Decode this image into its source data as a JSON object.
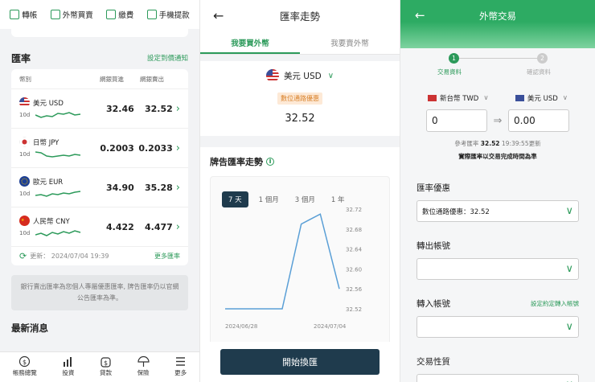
{
  "panel1": {
    "toolbar": [
      {
        "label": "轉帳",
        "icon": "transfer-icon"
      },
      {
        "label": "外幣買賣",
        "icon": "fx-trade-icon"
      },
      {
        "label": "繳費",
        "icon": "bill-icon"
      },
      {
        "label": "手機提款",
        "icon": "atm-icon"
      }
    ],
    "rates_title": "匯率",
    "notify_link": "設定到價通知",
    "headers": {
      "currency": "幣別",
      "buy": "網銀買進",
      "sell": "網銀賣出"
    },
    "rows": [
      {
        "name": "美元 USD",
        "period": "10d",
        "buy": "32.46",
        "sell": "32.52",
        "flag": "us"
      },
      {
        "name": "日幣 JPY",
        "period": "10d",
        "buy": "0.2003",
        "sell": "0.2033",
        "flag": "jp"
      },
      {
        "name": "歐元 EUR",
        "period": "10d",
        "buy": "34.90",
        "sell": "35.28",
        "flag": "eu"
      },
      {
        "name": "人民幣 CNY",
        "period": "10d",
        "buy": "4.422",
        "sell": "4.477",
        "flag": "cn"
      }
    ],
    "updated": "更新： 2024/07/04 19:39",
    "more_rates": "更多匯率",
    "notice": "銀行賣出匯率為您個人專屬優惠匯率, 牌告匯率仍以官網公告匯率為準。",
    "news_title": "最新消息",
    "bottom_nav": [
      {
        "label": "帳務總覽",
        "icon": "account-overview-icon"
      },
      {
        "label": "投資",
        "icon": "investment-icon"
      },
      {
        "label": "貸款",
        "icon": "loan-icon"
      },
      {
        "label": "保險",
        "icon": "insurance-icon"
      },
      {
        "label": "更多",
        "icon": "more-icon"
      }
    ]
  },
  "panel2": {
    "title": "匯率走勢",
    "tabs": [
      "我要買外幣",
      "我要賣外幣"
    ],
    "currency": "美元 USD",
    "badge": "數位通路優惠",
    "rate": "32.52",
    "chart_title": "牌告匯率走勢",
    "ranges": [
      "7 天",
      "1 個月",
      "3 個月",
      "1 年"
    ],
    "button": "開始換匯",
    "chart_data": {
      "type": "line",
      "x": [
        "2024/06/28",
        "2024/06/29",
        "2024/06/30",
        "2024/07/01",
        "2024/07/02",
        "2024/07/03",
        "2024/07/04"
      ],
      "values": [
        32.52,
        32.52,
        32.52,
        32.52,
        32.69,
        32.71,
        32.56
      ],
      "xlabels": [
        "2024/06/28",
        "2024/07/04"
      ],
      "yticks": [
        "32.72",
        "32.68",
        "32.64",
        "32.60",
        "32.56",
        "32.52"
      ],
      "ylim": [
        32.52,
        32.72
      ],
      "color": "#5a9fd6"
    }
  },
  "panel3": {
    "title": "外幣交易",
    "steps": [
      {
        "num": "1",
        "label": "交易資料"
      },
      {
        "num": "2",
        "label": "確認資料"
      }
    ],
    "from_currency": "新台幣 TWD",
    "to_currency": "美元 USD",
    "from_amount": "0",
    "to_amount": "0.00",
    "ref_prefix": "參考匯率",
    "ref_rate": "32.52",
    "ref_time": "19:39:55更新",
    "note": "實際匯率以交易完成時間為準",
    "discount_label": "匯率優惠",
    "discount_value": "數位通路優惠：32.52",
    "out_account_label": "轉出帳號",
    "in_account_label": "轉入帳號",
    "agreed_link": "設定約定轉入帳號",
    "tx_type_label": "交易性質"
  }
}
